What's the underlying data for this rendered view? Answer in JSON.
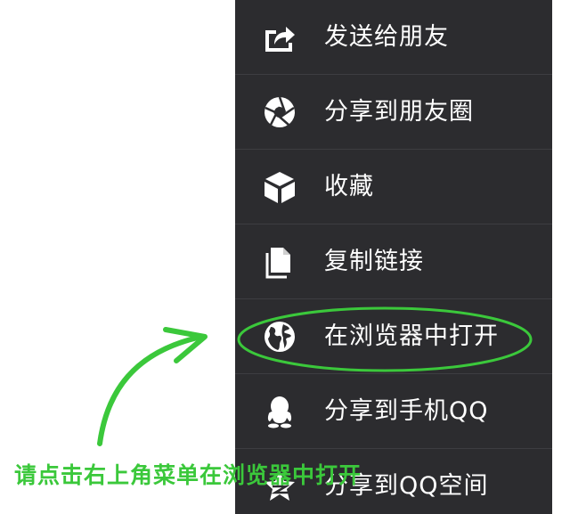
{
  "menu": {
    "items": [
      {
        "label": "发送给朋友",
        "icon": "share-icon"
      },
      {
        "label": "分享到朋友圈",
        "icon": "moments-icon"
      },
      {
        "label": "收藏",
        "icon": "favorite-cube-icon"
      },
      {
        "label": "复制链接",
        "icon": "copy-icon"
      },
      {
        "label": "在浏览器中打开",
        "icon": "globe-icon"
      },
      {
        "label": "分享到手机QQ",
        "icon": "qq-icon"
      },
      {
        "label": "分享到QQ空间",
        "icon": "qzone-icon"
      }
    ]
  },
  "annotation": {
    "instruction": "请点击右上角菜单在浏览器中打开",
    "highlight_color": "#3bc83b"
  },
  "colors": {
    "menu_bg": "#2c2c2f",
    "divider": "#3d3d41",
    "text": "#ffffff"
  }
}
